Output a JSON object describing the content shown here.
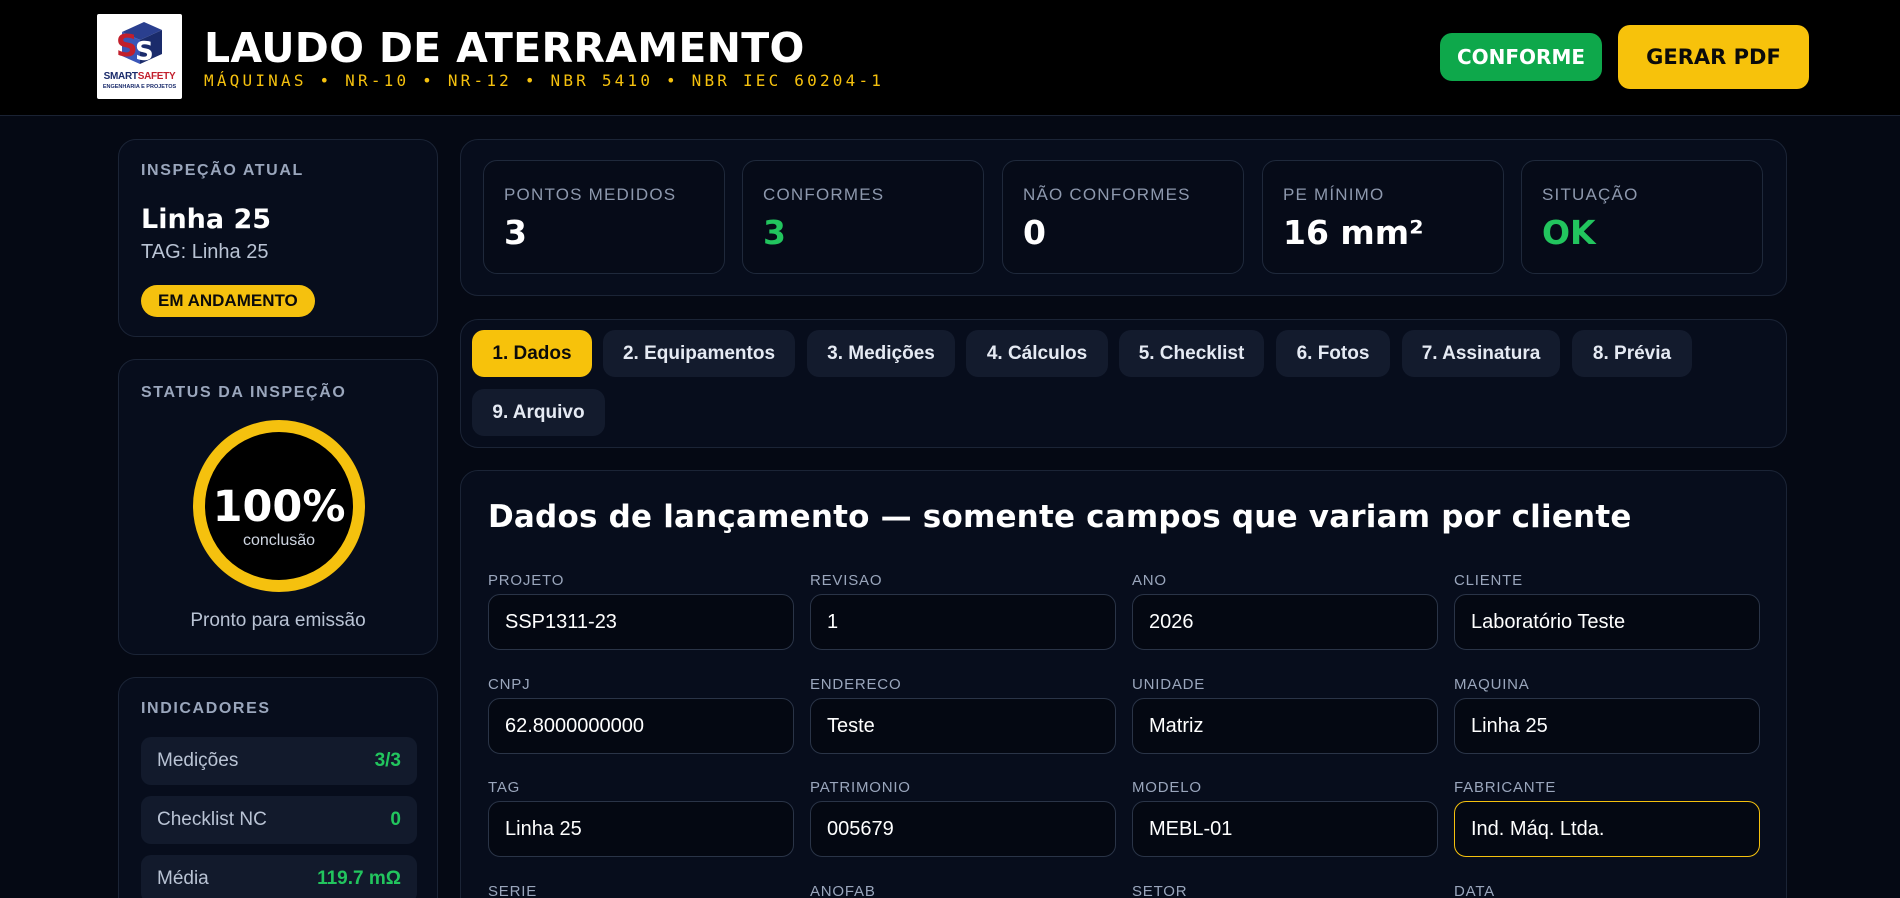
{
  "header": {
    "title": "LAUDO DE ATERRAMENTO",
    "subtitle": "MÁQUINAS • NR-10 • NR-12 • NBR 5410 • NBR IEC 60204-1",
    "conforme_label": "CONFORME",
    "pdf_label": "GERAR PDF",
    "logo": {
      "brand_a": "SMART",
      "brand_b": "SAFETY",
      "tagline": "ENGENHARIA E PROJETOS"
    }
  },
  "sidebar": {
    "current": {
      "label": "INSPEÇÃO ATUAL",
      "name": "Linha 25",
      "tag": "TAG: Linha 25",
      "badge": "EM ANDAMENTO"
    },
    "status": {
      "label": "STATUS DA INSPEÇÃO",
      "percent": "100%",
      "percent_caption": "conclusão",
      "ready_text": "Pronto para emissão",
      "color": "#f5c10e"
    },
    "indicators": {
      "label": "INDICADORES",
      "items": [
        {
          "key": "Medições",
          "value": "3/3"
        },
        {
          "key": "Checklist NC",
          "value": "0"
        },
        {
          "key": "Média",
          "value": "119.7 mΩ"
        }
      ]
    }
  },
  "stats": [
    {
      "label": "PONTOS MEDIDOS",
      "value": "3"
    },
    {
      "label": "CONFORMES",
      "value": "3"
    },
    {
      "label": "NÃO CONFORMES",
      "value": "0"
    },
    {
      "label": "PE MÍNIMO",
      "value": "16 mm²"
    },
    {
      "label": "SITUAÇÃO",
      "value": "OK"
    }
  ],
  "tabs": [
    "1. Dados",
    "2. Equipamentos",
    "3. Medições",
    "4. Cálculos",
    "5. Checklist",
    "6. Fotos",
    "7. Assinatura",
    "8. Prévia",
    "9. Arquivo"
  ],
  "form": {
    "title": "Dados de lançamento — somente campos que variam por cliente",
    "fields": [
      {
        "label": "PROJETO",
        "value": "SSP1311-23"
      },
      {
        "label": "REVISAO",
        "value": "1"
      },
      {
        "label": "ANO",
        "value": "2026"
      },
      {
        "label": "CLIENTE",
        "value": "Laboratório Teste"
      },
      {
        "label": "CNPJ",
        "value": "62.8000000000"
      },
      {
        "label": "ENDERECO",
        "value": "Teste"
      },
      {
        "label": "UNIDADE",
        "value": "Matriz"
      },
      {
        "label": "MAQUINA",
        "value": "Linha 25"
      },
      {
        "label": "TAG",
        "value": "Linha 25"
      },
      {
        "label": "PATRIMONIO",
        "value": "005679"
      },
      {
        "label": "MODELO",
        "value": "MEBL-01"
      },
      {
        "label": "FABRICANTE",
        "value": "Ind. Máq. Ltda."
      },
      {
        "label": "SERIE",
        "value": ""
      },
      {
        "label": "ANOFAB",
        "value": ""
      },
      {
        "label": "SETOR",
        "value": ""
      },
      {
        "label": "DATA",
        "value": ""
      }
    ]
  },
  "colors": {
    "accent": "#f7c20b",
    "success": "#22c55e",
    "conforme_button": "#0ea84b",
    "background": "#050914"
  }
}
